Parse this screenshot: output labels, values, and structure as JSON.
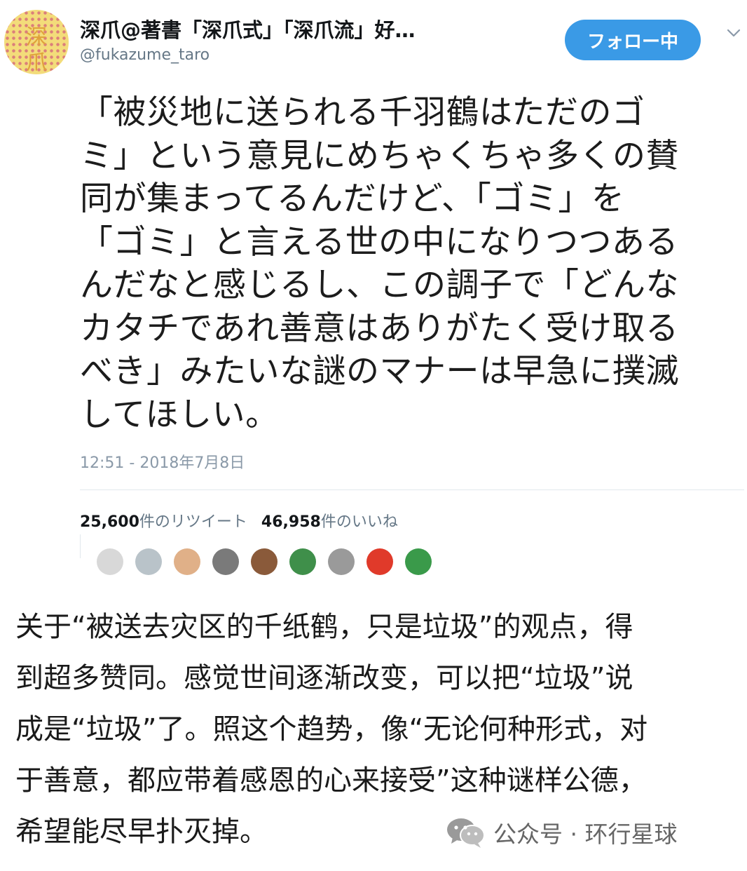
{
  "tweet": {
    "avatar_glyphs": [
      "深",
      "爪"
    ],
    "display_name": "深爪@著書「深爪式」「深爪流」好…",
    "screen_name": "@fukazume_taro",
    "follow_label": "フォロー中",
    "text_lines": [
      "「被災地に送られる千羽鶴はただのゴ",
      "ミ」という意見にめちゃくちゃ多くの賛",
      "同が集まってるんだけど、「ゴミ」を",
      "「ゴミ」と言える世の中になりつつある",
      "んだなと感じるし、この調子で「どんな",
      "カタチであれ善意はありがたく受け取る",
      "べき」みたいな謎のマナーは早急に撲滅",
      "してほしい。"
    ],
    "timestamp": "12:51 - 2018年7月8日",
    "retweet_count": "25,600",
    "retweet_label": "件のリツイート",
    "like_count": "46,958",
    "like_label": "件のいいね",
    "liker_colors": [
      "#d8d8d8",
      "#b9c3c9",
      "#e0b088",
      "#7a7a7a",
      "#8a5a3a",
      "#3f8f4a",
      "#9a9a9a",
      "#e03a2a",
      "#3a9a4a"
    ],
    "accent_color": "#3a9ae6"
  },
  "translation": {
    "lines": [
      "关于“被送去灾区的千纸鹤，只是垃圾”的观点，得",
      "到超多赞同。感觉世间逐渐改变，可以把“垃圾”说",
      "成是“垃圾”了。照这个趋势，像“无论何种形式，对",
      "于善意，都应带着感恩的心来接受”这种谜样公德，",
      "希望能尽早扑灭掉。"
    ]
  },
  "watermark": {
    "icon": "wechat-icon",
    "text": "公众号 · 环行星球"
  }
}
